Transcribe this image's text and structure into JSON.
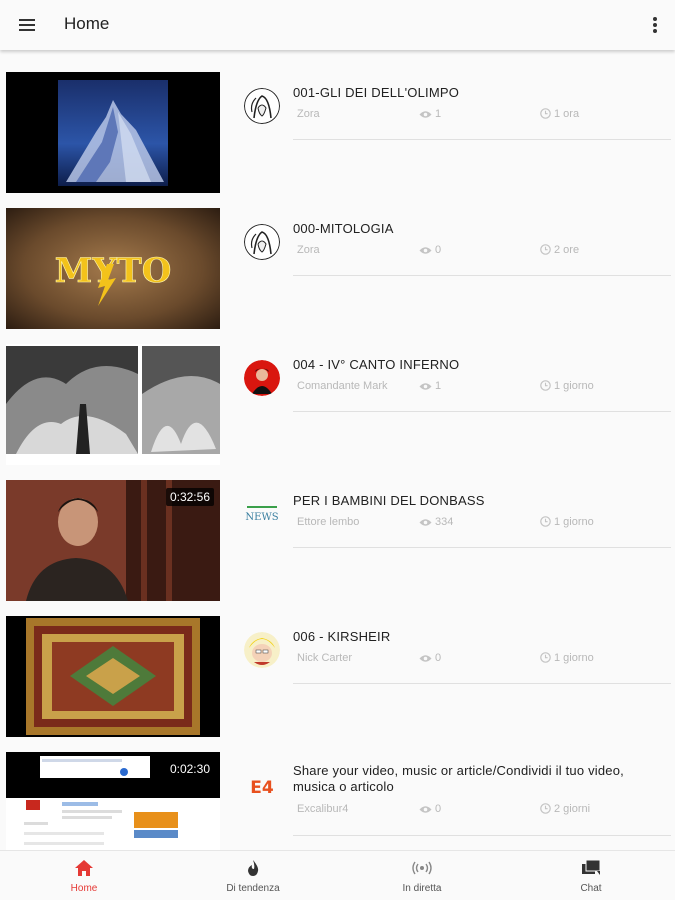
{
  "appbar": {
    "title": "Home"
  },
  "videos": [
    {
      "title": "001-GLI DEI DELL'OLIMPO",
      "author": "Zora",
      "views": "1",
      "age": "1 ora",
      "duration": ""
    },
    {
      "title": "000-MITOLOGIA",
      "author": "Zora",
      "views": "0",
      "age": "2 ore",
      "duration": "",
      "thumb_text": "MYTO"
    },
    {
      "title": "004 - IV° CANTO INFERNO",
      "author": "Comandante Mark",
      "views": "1",
      "age": "1 giorno",
      "duration": ""
    },
    {
      "title": "PER I BAMBINI DEL DONBASS",
      "author": "Ettore lembo",
      "views": "334",
      "age": "1 giorno",
      "duration": "0:32:56",
      "avatar_text": "NEWS"
    },
    {
      "title": "006 - KIRSHEIR",
      "author": "Nick Carter",
      "views": "0",
      "age": "1 giorno",
      "duration": ""
    },
    {
      "title": "Share your video, music or article/Condividi il tuo video, musica o articolo",
      "author": "Excalibur4",
      "views": "0",
      "age": "2 giorni",
      "duration": "0:02:30",
      "avatar_text": "E4"
    }
  ],
  "bottom_nav": [
    {
      "label": "Home",
      "icon": "home-icon",
      "active": true
    },
    {
      "label": "Di tendenza",
      "icon": "flame-icon",
      "active": false
    },
    {
      "label": "In diretta",
      "icon": "live-icon",
      "active": false
    },
    {
      "label": "Chat",
      "icon": "chat-icon",
      "active": false
    }
  ],
  "colors": {
    "accent": "#e53935",
    "meta": "#b8b8b8",
    "divider": "#e0e0e0"
  }
}
